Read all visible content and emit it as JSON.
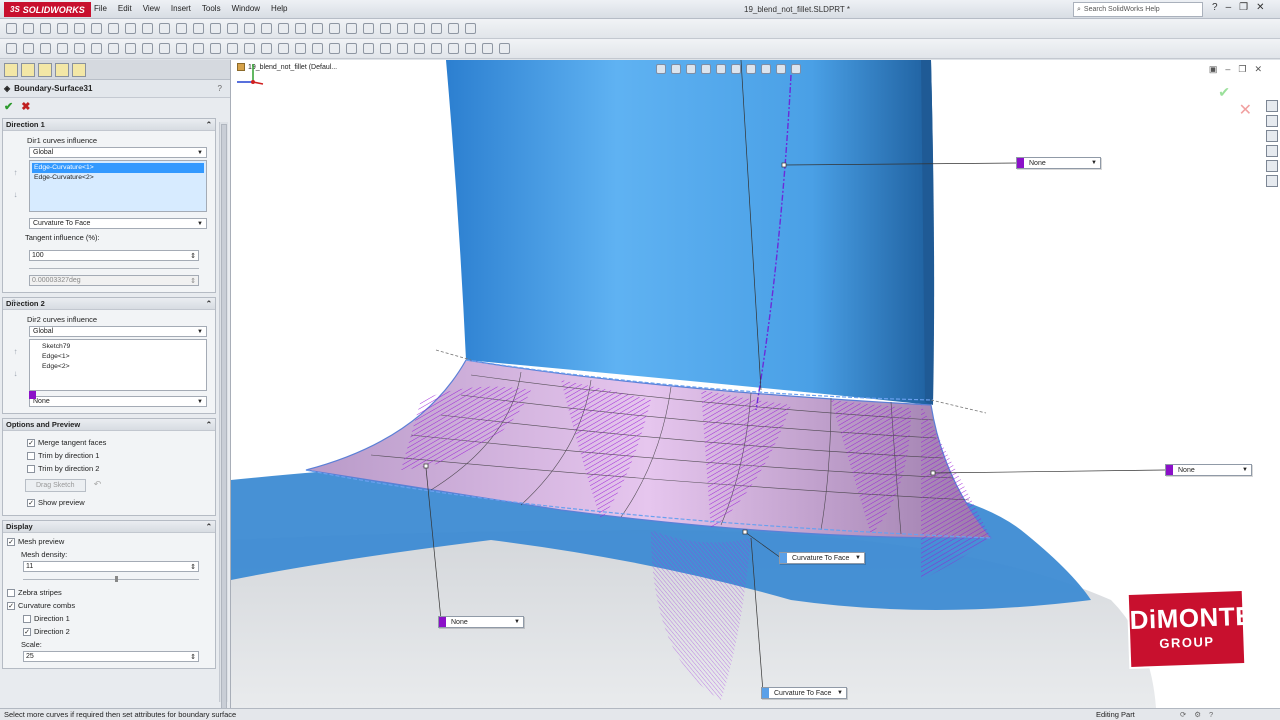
{
  "app": {
    "name": "SOLIDWORKS",
    "doc_title": "19_blend_not_fillet.SLDPRT *"
  },
  "menu": [
    "File",
    "Edit",
    "View",
    "Insert",
    "Tools",
    "Window",
    "Help"
  ],
  "search": {
    "placeholder": "Search SolidWorks Help"
  },
  "feature": {
    "name": "Boundary-Surface31",
    "help": "?"
  },
  "direction1": {
    "header": "Direction 1",
    "influence_label": "Dir1 curves influence",
    "influence_value": "Global",
    "curves": [
      "Edge-Curvature<1>",
      "Edge-Curvature<2>"
    ],
    "condition": "Curvature To Face",
    "tangent_label": "Tangent influence (%):",
    "tangent_value": "100",
    "angle_value": "0.00003327deg"
  },
  "direction2": {
    "header": "Direction 2",
    "influence_label": "Dir2 curves influence",
    "influence_value": "Global",
    "curves": [
      "Sketch79",
      "Edge<1>",
      "Edge<2>"
    ],
    "condition": "None"
  },
  "options": {
    "header": "Options and Preview",
    "merge": "Merge tangent faces",
    "trim1": "Trim by direction 1",
    "trim2": "Trim by direction 2",
    "drag": "Drag Sketch",
    "show_preview": "Show preview"
  },
  "display": {
    "header": "Display",
    "mesh_preview": "Mesh preview",
    "mesh_density_label": "Mesh density:",
    "mesh_density": "11",
    "zebra": "Zebra stripes",
    "combs": "Curvature combs",
    "dir1": "Direction 1",
    "dir2": "Direction 2",
    "scale_label": "Scale:",
    "scale_value": "25"
  },
  "viewport": {
    "tree_label": "19_blend_not_fillet  (Defaul...",
    "callouts": {
      "top_right": "None",
      "mid_right": "None",
      "bottom_left": "None",
      "center": "Curvature To Face",
      "bottom": "Curvature To Face"
    },
    "brand_line1": "DiMONTE",
    "brand_line2": "GROUP"
  },
  "status": {
    "message": "Select more curves if required then set attributes for boundary surface",
    "mode": "Editing Part"
  },
  "colors": {
    "accent_red": "#c8102e",
    "comb_purple": "#8b10c8",
    "surface_blue": "#3b8fd6"
  }
}
